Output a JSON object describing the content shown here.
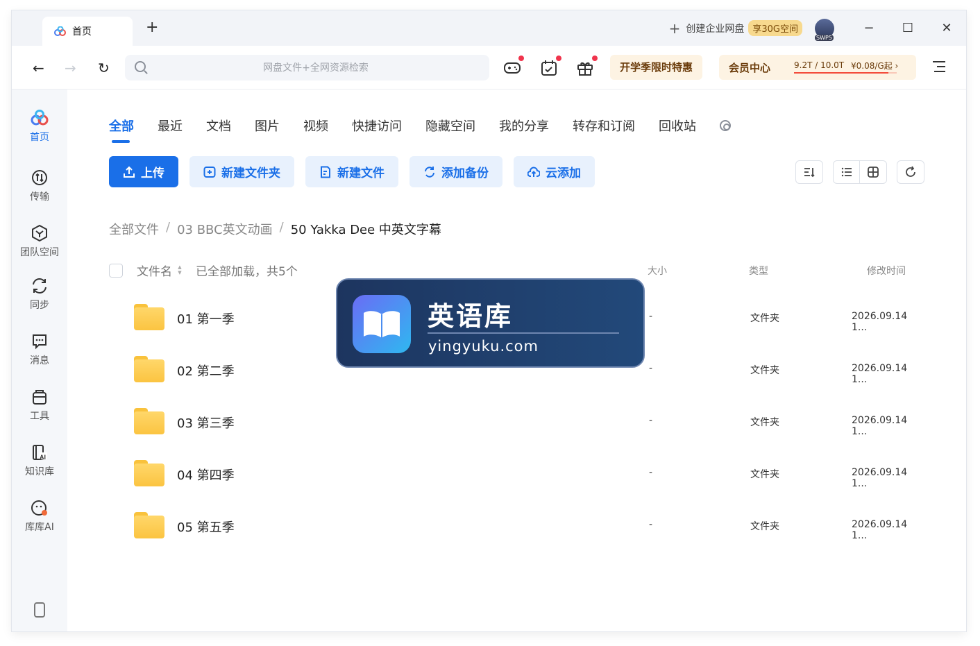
{
  "titlebar": {
    "tab_label": "首页",
    "new_tab": "+",
    "create_enterprise": "创建企业网盘",
    "create_enterprise_badge": "享30G空间",
    "avatar_badge": "SWP5",
    "minimize": "−",
    "maximize": "☐",
    "close": "✕"
  },
  "toolbar": {
    "back": "←",
    "forward": "→",
    "refresh": "↻",
    "search_placeholder": "网盘文件+全网资源检索",
    "promo_label": "开学季限时特惠",
    "vip_label": "会员中心",
    "storage_text": "9.2T / 10.0T",
    "price_text": "¥0.08/G起",
    "storage_used_fraction": 0.92,
    "price_arrow": "›"
  },
  "sidebar": {
    "items": [
      {
        "label": "首页",
        "icon": "home-logo-icon"
      },
      {
        "label": "传输",
        "icon": "transfer-icon"
      },
      {
        "label": "团队空间",
        "icon": "team-space-icon"
      },
      {
        "label": "同步",
        "icon": "sync-icon"
      },
      {
        "label": "消息",
        "icon": "message-icon"
      },
      {
        "label": "工具",
        "icon": "tools-icon"
      },
      {
        "label": "知识库",
        "icon": "knowledge-base-icon"
      },
      {
        "label": "库库AI",
        "icon": "kuku-ai-icon"
      }
    ]
  },
  "categories": [
    "全部",
    "最近",
    "文档",
    "图片",
    "视频",
    "快捷访问",
    "隐藏空间",
    "我的分享",
    "转存和订阅",
    "回收站"
  ],
  "actions": {
    "upload": "上传",
    "new_folder": "新建文件夹",
    "new_file": "新建文件",
    "add_backup": "添加备份",
    "cloud_add": "云添加"
  },
  "breadcrumb": [
    "全部文件",
    "03 BBC英文动画",
    "50 Yakka Dee 中英文字幕"
  ],
  "breadcrumb_sep": "/",
  "table": {
    "col_name": "文件名",
    "sort_glyph": "▲▼",
    "loaded_status": "已全部加载，共5个",
    "col_size": "大小",
    "col_type": "类型",
    "col_time": "修改时间",
    "rows": [
      {
        "name": "01 第一季",
        "size": "-",
        "type": "文件夹",
        "time": "2026.09.14 1..."
      },
      {
        "name": "02 第二季",
        "size": "-",
        "type": "文件夹",
        "time": "2026.09.14 1..."
      },
      {
        "name": "03 第三季",
        "size": "-",
        "type": "文件夹",
        "time": "2026.09.14 1..."
      },
      {
        "name": "04 第四季",
        "size": "-",
        "type": "文件夹",
        "time": "2026.09.14 1..."
      },
      {
        "name": "05 第五季",
        "size": "-",
        "type": "文件夹",
        "time": "2026.09.14 1..."
      }
    ]
  },
  "watermark": {
    "title": "英语库",
    "url": "yingyuku.com"
  },
  "colors": {
    "accent": "#1a6fe8",
    "badge_red": "#f0344c",
    "promo_bg": "#fdf3e3",
    "folder": "#fbc441"
  }
}
